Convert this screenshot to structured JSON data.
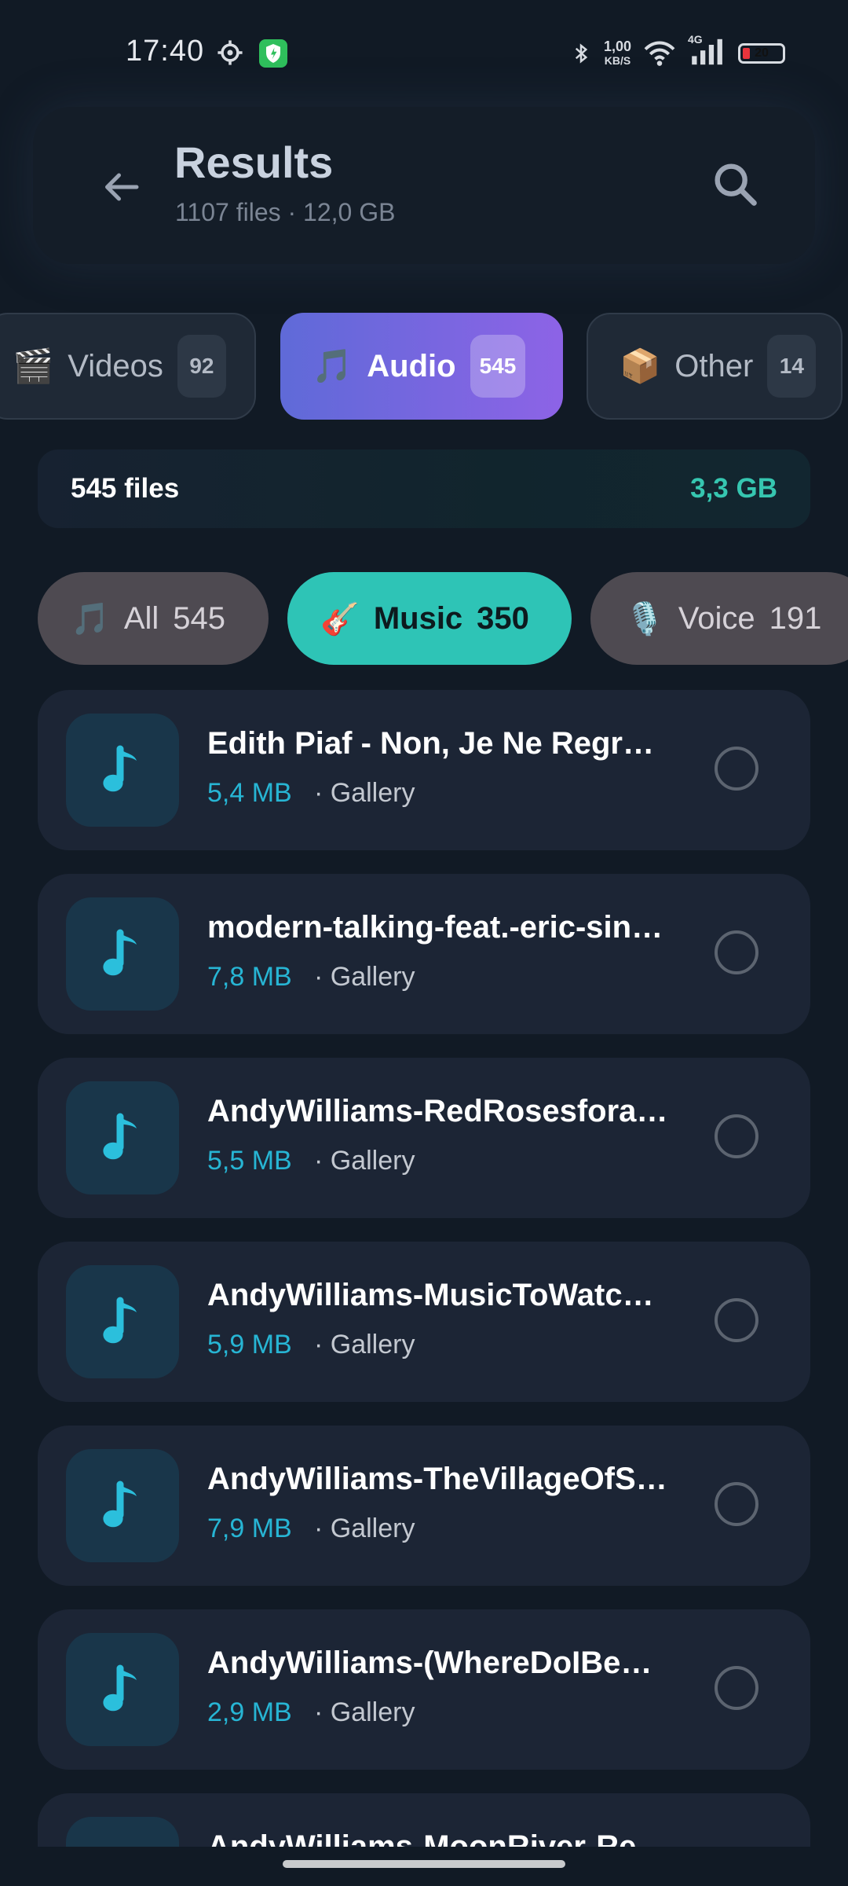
{
  "status_bar": {
    "time": "17:40",
    "net_speed_value": "1,00",
    "net_speed_unit": "KB/S",
    "network": "4G",
    "battery": "20",
    "icons": [
      "gear-icon",
      "shield-icon",
      "bluetooth-icon",
      "wifi-icon",
      "signal-icon",
      "battery-icon"
    ]
  },
  "header": {
    "title": "Results",
    "subtitle": "1107 files · 12,0 GB",
    "back_icon": "arrow-left-icon",
    "search_icon": "search-icon"
  },
  "type_tabs": [
    {
      "emoji": "🎬",
      "label": "Videos",
      "count": "92",
      "active": false
    },
    {
      "emoji": "🎵",
      "label": "Audio",
      "count": "545",
      "active": true
    },
    {
      "emoji": "📦",
      "label": "Other",
      "count": "14",
      "active": false
    }
  ],
  "summary": {
    "count_label": "545 files",
    "size_label": "3,3 GB"
  },
  "filter_chips": [
    {
      "emoji": "🎵",
      "label": "All",
      "count": "545",
      "active": false
    },
    {
      "emoji": "🎸",
      "label": "Music",
      "count": "350",
      "active": true
    },
    {
      "emoji": "🎙️",
      "label": "Voice",
      "count": "191",
      "active": false
    }
  ],
  "files": [
    {
      "name": "Edith Piaf - Non, Je Ne Regrette Rien",
      "size": "5,4 MB",
      "source": "· Gallery"
    },
    {
      "name": "modern-talking-feat.-eric-singleton",
      "size": "7,8 MB",
      "source": "· Gallery"
    },
    {
      "name": "AndyWilliams-RedRosesforaBlueLady",
      "size": "5,5 MB",
      "source": "· Gallery"
    },
    {
      "name": "AndyWilliams-MusicToWatchGirlsBy",
      "size": "5,9 MB",
      "source": "· Gallery"
    },
    {
      "name": "AndyWilliams-TheVillageOfStBernadette",
      "size": "7,9 MB",
      "source": "· Gallery"
    },
    {
      "name": "AndyWilliams-(WhereDoIBegin)LoveStory",
      "size": "2,9 MB",
      "source": "· Gallery"
    },
    {
      "name": "AndyWilliams-MoonRiver-Remastered",
      "size": "",
      "source": ""
    }
  ],
  "colors": {
    "background": "#111a25",
    "accent_purple": "#7b66e0",
    "accent_teal": "#2ec4b6",
    "size_blue": "#27b5d4"
  }
}
